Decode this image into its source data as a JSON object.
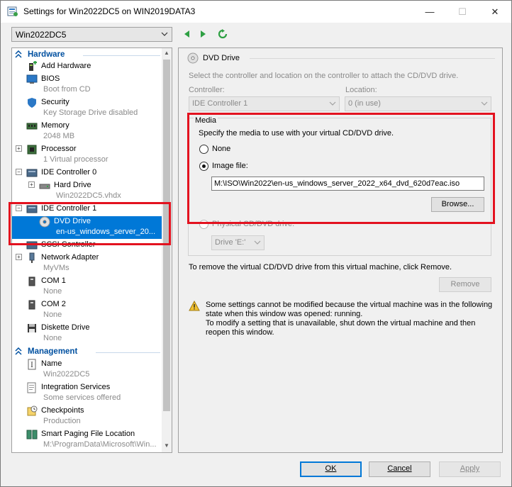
{
  "window": {
    "title": "Settings for Win2022DC5 on WIN2019DATA3",
    "min_glyph": "—",
    "max_glyph": "☐",
    "close_glyph": "✕"
  },
  "toolbar": {
    "vm_selected": "Win2022DC5"
  },
  "sidebar": {
    "hardware_label": "Hardware",
    "management_label": "Management",
    "items": [
      {
        "name": "Add Hardware",
        "sub": "",
        "icon": "add-hardware-icon"
      },
      {
        "name": "BIOS",
        "sub": "Boot from CD",
        "icon": "bios-icon"
      },
      {
        "name": "Security",
        "sub": "Key Storage Drive disabled",
        "icon": "shield-icon"
      },
      {
        "name": "Memory",
        "sub": "2048 MB",
        "icon": "memory-icon"
      },
      {
        "name": "Processor",
        "sub": "1 Virtual processor",
        "icon": "processor-icon"
      },
      {
        "name": "IDE Controller 0",
        "sub": "",
        "icon": "controller-icon"
      },
      {
        "name": "Hard Drive",
        "sub": "Win2022DC5.vhdx",
        "icon": "hard-drive-icon"
      },
      {
        "name": "IDE Controller 1",
        "sub": "",
        "icon": "controller-icon"
      },
      {
        "name": "DVD Drive",
        "sub": "en-us_windows_server_20...",
        "icon": "dvd-icon"
      },
      {
        "name": "SCSI Controller",
        "sub": "",
        "icon": "controller-icon"
      },
      {
        "name": "Network Adapter",
        "sub": "MyVMs",
        "icon": "network-icon"
      },
      {
        "name": "COM 1",
        "sub": "None",
        "icon": "com-port-icon"
      },
      {
        "name": "COM 2",
        "sub": "None",
        "icon": "com-port-icon"
      },
      {
        "name": "Diskette Drive",
        "sub": "None",
        "icon": "diskette-icon"
      },
      {
        "name": "Name",
        "sub": "Win2022DC5",
        "icon": "name-icon"
      },
      {
        "name": "Integration Services",
        "sub": "Some services offered",
        "icon": "integration-icon"
      },
      {
        "name": "Checkpoints",
        "sub": "Production",
        "icon": "checkpoint-icon"
      },
      {
        "name": "Smart Paging File Location",
        "sub": "M:\\ProgramData\\Microsoft\\Win...",
        "icon": "paging-icon"
      }
    ]
  },
  "panel": {
    "header": "DVD Drive",
    "intro": "Select the controller and location on the controller to attach the CD/DVD drive.",
    "controller_label": "Controller:",
    "controller_value": "IDE Controller 1",
    "location_label": "Location:",
    "location_value": "0 (in use)",
    "media_label": "Media",
    "media_desc": "Specify the media to use with your virtual CD/DVD drive.",
    "none_label": "None",
    "image_label": "Image file:",
    "image_path": "M:\\ISO\\Win2022\\en-us_windows_server_2022_x64_dvd_620d7eac.iso",
    "browse_label": "Browse...",
    "physical_label": "Physical CD/DVD drive:",
    "physical_value": "Drive 'E:'",
    "remove_desc": "To remove the virtual CD/DVD drive from this virtual machine, click Remove.",
    "remove_label": "Remove",
    "warn_line1": "Some settings cannot be modified because the virtual machine was in the following",
    "warn_line2": "state when this window was opened: running.",
    "warn_line3": "To modify a setting that is unavailable, shut down the virtual machine and then",
    "warn_line4": "reopen this window."
  },
  "footer": {
    "ok_label": "OK",
    "cancel_label": "Cancel",
    "apply_label": "Apply"
  },
  "colors": {
    "selection": "#0078d7",
    "highlight_box": "#e3121f",
    "section_header": "#0050a0",
    "nav_green": "#2ea043"
  }
}
